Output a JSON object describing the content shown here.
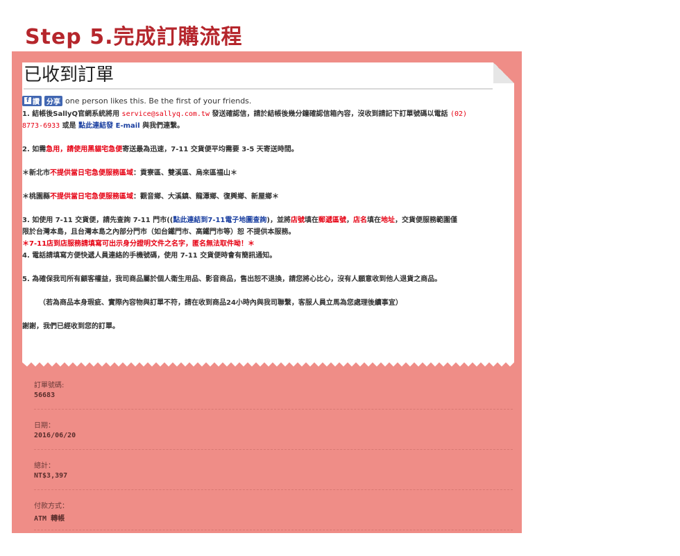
{
  "step_title": "Step 5.完成訂購流程",
  "paper_title": "已收到訂單",
  "social": {
    "fb_label": "讚",
    "share_label": "分享",
    "likes_text": "one person likes this. Be the first of your friends."
  },
  "content": {
    "l1_a": "1. 結帳後SallyQ官網系統將用 ",
    "l1_email": "service@sallyq.com.tw",
    "l1_b": " 發送確認信，請於結帳後幾分鐘確認信箱內容，沒收到請記下訂單號碼以電話 ",
    "l1_phone_a": "(02)",
    "l1_phone_b": "8773-6933",
    "l1_c": "  或是 ",
    "l1_link": "點此連結發 E-mail",
    "l1_d": " 與我們連繫。",
    "l2_a": "2. 如需",
    "l2_red1": "急用，請使用黑貓宅急便",
    "l2_b": "寄送最為迅速，7-11 交貨便平均需要 3-5 天寄送時間。",
    "l3_a": "＊新北市",
    "l3_red": "不提供當日宅急便服務區域",
    "l3_b": "：貢寮區、雙溪區、烏來區福山＊",
    "l4_a": "＊桃園縣",
    "l4_red": "不提供當日宅急便服務區域",
    "l4_b": "：觀音鄉、大溪鎮、龍潭鄉、復興鄉、新屋鄉＊",
    "l5_a": "3. 如使用 7-11 交貨便，請先查詢 7-11 門市((",
    "l5_link": "點此連結到7-11電子地圖查詢",
    "l5_b": ")，並將",
    "l5_red1": "店號",
    "l5_c": "填在",
    "l5_red2": "郵遞區號",
    "l5_d": "，",
    "l5_red3": "店名",
    "l5_e": "填在",
    "l5_red4": "地址",
    "l5_f": "，交貨便服務範圍僅",
    "l6": "限於台灣本島，且台灣本島之內部分門市（如台鐵門市、高鐵門市等）恕 不提供本服務。",
    "l7_red": "＊7-11店到店服務請填寫可出示身分證明文件之名字，匿名無法取件呦！＊",
    "l8": "4. 電話請填寫方便快遞人員連絡的手機號碼，使用 7-11 交貨便時會有簡訊通知。",
    "l9": "5. 為確保我司所有顧客權益，我司商品屬於個人衛生用品、影音商品，售出恕不退換，請您將心比心，沒有人願意收到他人退貨之商品。",
    "l10": "（若為商品本身瑕疵、實際內容物與訂單不符，請在收到商品24小時內與我司聯繫，客服人員立馬為您處理後續事宜）",
    "l11": "謝謝，我們已經收到您的訂單。"
  },
  "order": {
    "number_label": "訂單號碼:",
    "number_value": "56683",
    "date_label": "日期：",
    "date_value": "2016/06/20",
    "total_label": "總計：",
    "total_value": "NT$3,397",
    "payment_label": "付款方式：",
    "payment_value": "ATM 轉帳"
  },
  "colors": {
    "accent": "#b5262c",
    "panel": "#ef8d87",
    "link": "#1a3fa0",
    "highlight": "#e60012"
  }
}
